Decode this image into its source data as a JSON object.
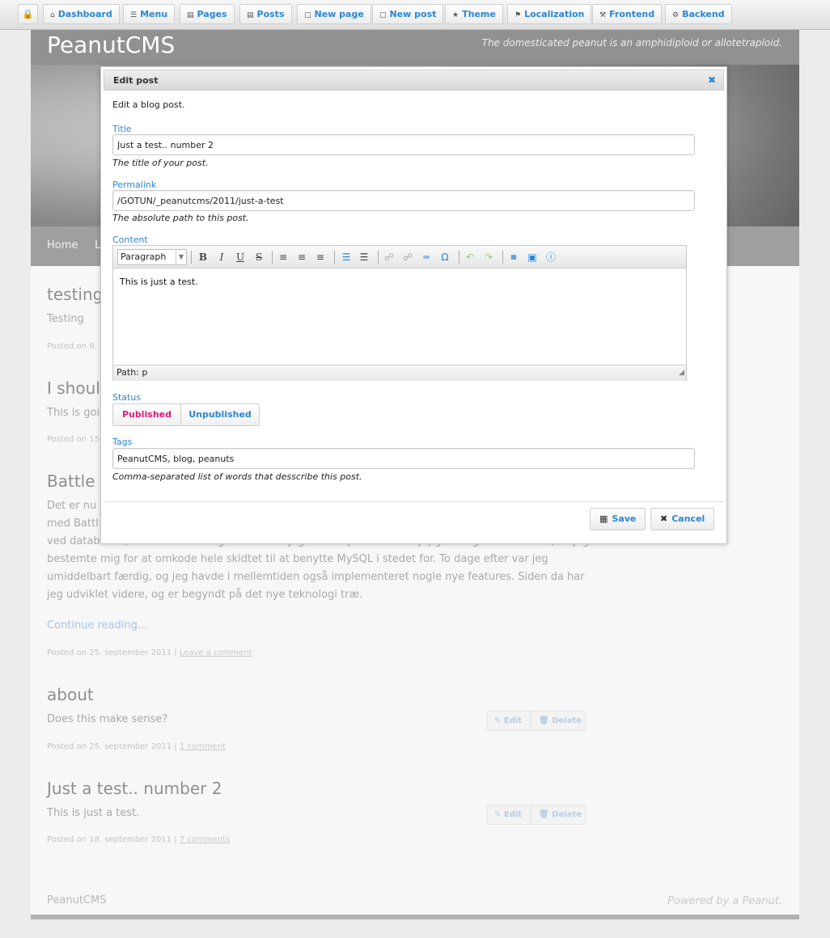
{
  "toolbar": {
    "lock_icon": "lock-icon",
    "items": [
      {
        "label": "Dashboard",
        "icon": "home-icon"
      },
      {
        "label": "Menu",
        "icon": "menu-icon"
      },
      {
        "label": "Pages",
        "icon": "folder-icon"
      },
      {
        "label": "Posts",
        "icon": "folder-icon"
      },
      {
        "label": "New page",
        "icon": "document-icon"
      },
      {
        "label": "New post",
        "icon": "document-icon"
      },
      {
        "label": "Theme",
        "icon": "star-icon"
      },
      {
        "label": "Localization",
        "icon": "flag-icon"
      },
      {
        "label": "Frontend",
        "icon": "wrench-icon"
      },
      {
        "label": "Backend",
        "icon": "gear-icon"
      }
    ]
  },
  "site": {
    "title": "PeanutCMS",
    "slogan": "The domesticated peanut is an amphidiploid or allotetraploid.",
    "nav": [
      "Home",
      "L"
    ]
  },
  "posts": [
    {
      "title": "testing",
      "body": "Testing",
      "meta": "Posted on 9."
    },
    {
      "title": "I shoul",
      "body": "This is goi",
      "meta": "Posted on 15"
    },
    {
      "title": "Battle o",
      "body_lines": [
        "Det er nu",
        "med Battl",
        "ved databasen, men allerede dagen efter løb jeg ind i et problem netop pga. brug af databasen, så jeg",
        "bestemte mig for at omkode hele skidtet til at benytte MySQL i stedet for. To dage efter var jeg",
        "umiddelbart færdig, og jeg havde i mellemtiden også implementeret nogle nye features. Siden da har",
        "jeg udviklet videre, og er begyndt på det nye teknologi træ."
      ],
      "continue": "Continue reading...",
      "meta": "Posted on 25. september 2011 | ",
      "comment_link": "Leave a comment"
    },
    {
      "title": "about",
      "body": "Does this make sense?",
      "meta": "Posted on 25. september 2011 | ",
      "comment_link": "1 comment",
      "edit": "Edit",
      "delete": "Delete"
    },
    {
      "title": "Just a test.. number 2",
      "body": "This is just a test.",
      "meta": "Posted on 18. september 2011 | ",
      "comment_link": "7 comments",
      "edit": "Edit",
      "delete": "Delete"
    }
  ],
  "footer": {
    "left": "PeanutCMS",
    "right": "Powered by a Peanut."
  },
  "modal": {
    "title": "Edit post",
    "close_icon": "close-icon",
    "description": "Edit a blog post.",
    "title_field": {
      "label": "Title",
      "value": "Just a test.. number 2",
      "help": "The title of your post."
    },
    "permalink_field": {
      "label": "Permalink",
      "value": "/GOTUN/_peanutcms/2011/just-a-test",
      "help": "The absolute path to this post."
    },
    "content_field": {
      "label": "Content",
      "format_select": "Paragraph",
      "text": "This is just a test.",
      "status_path": "Path: p",
      "toolbar_icons": [
        "bold-icon",
        "italic-icon",
        "underline-icon",
        "strikethrough-icon",
        "align-left-icon",
        "align-center-icon",
        "align-right-icon",
        "ordered-list-icon",
        "unordered-list-icon",
        "link-icon",
        "unlink-icon",
        "horizontal-rule-icon",
        "special-char-icon",
        "undo-icon",
        "redo-icon",
        "html-source-icon",
        "visual-aid-icon",
        "help-icon"
      ]
    },
    "status_field": {
      "label": "Status",
      "published": "Published",
      "unpublished": "Unpublished"
    },
    "tags_field": {
      "label": "Tags",
      "value": "PeanutCMS, blog, peanuts",
      "help": "Comma-separated list of words that desscribe this post."
    },
    "save_label": "Save",
    "cancel_label": "Cancel"
  },
  "colors": {
    "accent": "#2a86d6",
    "published": "#e0197d"
  }
}
